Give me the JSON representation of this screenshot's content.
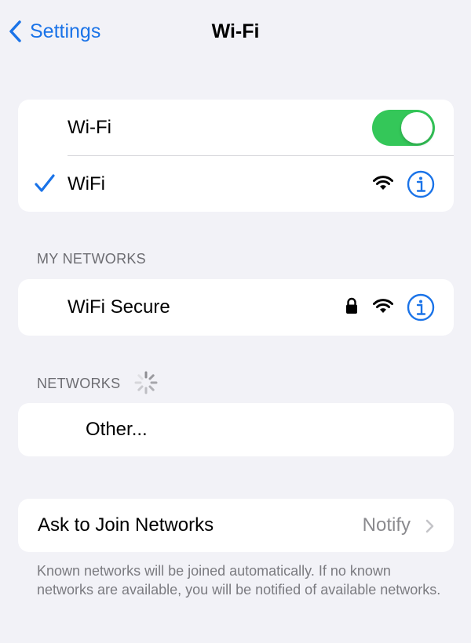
{
  "nav": {
    "back_label": "Settings",
    "title": "Wi-Fi"
  },
  "wifi_card": {
    "toggle_label": "Wi-Fi",
    "toggle_on": true,
    "connected_network": "WiFi"
  },
  "my_networks": {
    "header": "MY NETWORKS",
    "items": [
      {
        "name": "WiFi Secure",
        "locked": true
      }
    ]
  },
  "networks": {
    "header": "NETWORKS",
    "other_label": "Other..."
  },
  "ask_to_join": {
    "label": "Ask to Join Networks",
    "value": "Notify",
    "footer": "Known networks will be joined automatically. If no known networks are available, you will be notified of available networks."
  },
  "colors": {
    "accent": "#1a73e8",
    "toggle_on": "#34c759",
    "background": "#f2f2f7"
  },
  "icons": {
    "back": "chevron-left-icon",
    "check": "checkmark-icon",
    "wifi": "wifi-icon",
    "lock": "lock-icon",
    "info": "info-icon",
    "spinner": "spinner-icon",
    "chevron": "chevron-right-icon"
  }
}
